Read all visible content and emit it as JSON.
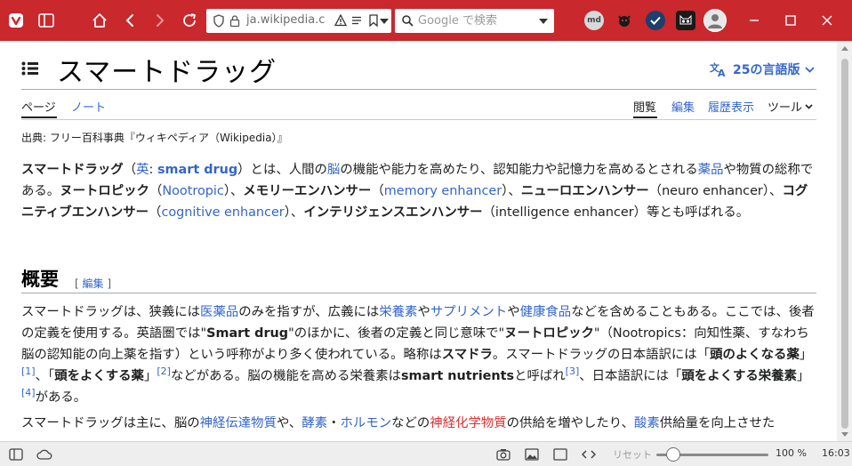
{
  "browser": {
    "url": "ja.wikipedia.c",
    "search_placeholder": "Google で検索",
    "extensions": [
      "md-icon",
      "devil-icon",
      "check-shield-icon",
      "cat-icon"
    ],
    "accent_color": "#c9282d"
  },
  "article": {
    "title": "スマートドラッグ",
    "languages_label": "25の言語版",
    "tabs": {
      "page": "ページ",
      "talk": "ノート",
      "read": "閲覧",
      "edit": "編集",
      "history": "履歴表示",
      "tools": "ツール"
    },
    "source": "出典: フリー百科事典『ウィキペディア（Wikipedia）』",
    "intro": {
      "t1": "スマートドラッグ",
      "t2": "（",
      "t3": "英",
      "t4": ": ",
      "t5": "smart drug",
      "t6": "）とは、人間の",
      "t7": "脳",
      "t8": "の機能や能力を高めたり、認知能力や記憶力を高めるとされる",
      "t9": "薬品",
      "t10": "や物質の総称である。",
      "t11": "ヌートロピック",
      "t12": "（",
      "t13": "Nootropic",
      "t14": "）、",
      "t15": "メモリーエンハンサー",
      "t16": "（",
      "t17": "memory enhancer",
      "t18": "）、",
      "t19": "ニューロエンハンサー",
      "t20": "（neuro enhancer）、",
      "t21": "コグニティブエンハンサー",
      "t22": "（",
      "t23": "cognitive enhancer",
      "t24": "）、",
      "t25": "インテリジェンスエンハンサー",
      "t26": "（intelligence enhancer）等とも呼ばれる。"
    },
    "section": {
      "heading": "概要",
      "edit_open": "[ ",
      "edit_label": "編集",
      "edit_close": " ]"
    },
    "overview": {
      "t1": "スマートドラッグは、狭義には",
      "t2": "医薬品",
      "t3": "のみを指すが、広義には",
      "t4": "栄養素",
      "t5": "や",
      "t6": "サプリメント",
      "t7": "や",
      "t8": "健康食品",
      "t9": "などを含めることもある。ここでは、後者の定義を使用する。英語圏では\"",
      "t10": "Smart drug",
      "t11": "\"のほかに、後者の定義と同じ意味で\"",
      "t12": "ヌートロピック",
      "t13": "\"（Nootropics：向知性薬、すなわち脳の認知能の向上薬を指す）という呼称がより多く使われている。略称は",
      "t14": "スマドラ",
      "t15": "。スマートドラッグの日本語訳には「",
      "t16": "頭のよくなる薬",
      "t17": "」",
      "t18": "[1]",
      "t19": "、「",
      "t20": "頭をよくする薬",
      "t21": "」",
      "t22": "[2]",
      "t23": "などがある。脳の機能を高める栄養素は",
      "t24": "smart nutrients",
      "t25": "と呼ばれ",
      "t26": "[3]",
      "t27": "、日本語訳には「",
      "t28": "頭をよくする栄養素",
      "t29": "」",
      "t30": "[4]",
      "t31": "がある。"
    },
    "para3": {
      "t1": "スマートドラッグは主に、脳の",
      "t2": "神経伝達物質",
      "t3": "や、",
      "t4": "酵素",
      "t5": "・",
      "t6": "ホルモン",
      "t7": "などの",
      "t8": "神経化学物質",
      "t9": "の供給を増やしたり、",
      "t10": "酸素",
      "t11": "供給量を向上させた"
    }
  },
  "statusbar": {
    "reset_label": "リセット",
    "zoom_label": "100 %",
    "zoom_fraction": 0.15,
    "clock": "16:03"
  }
}
